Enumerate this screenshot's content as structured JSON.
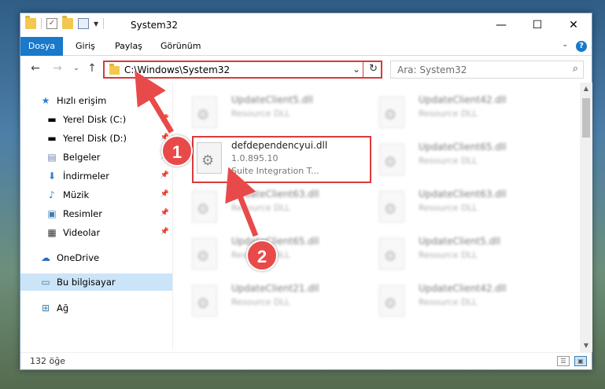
{
  "window": {
    "title": "System32",
    "controls": [
      "—",
      "☐",
      "✕"
    ]
  },
  "ribbon": {
    "tabs": [
      "Dosya",
      "Giriş",
      "Paylaş",
      "Görünüm"
    ],
    "help": "?"
  },
  "address": {
    "path": "C:\\Windows\\System32",
    "search_placeholder": "Ara: System32"
  },
  "sidebar": {
    "items": [
      {
        "label": "Hızlı erişim",
        "icon": "star-icon"
      },
      {
        "label": "Yerel Disk (C:)",
        "icon": "drive-icon"
      },
      {
        "label": "Yerel Disk (D:)",
        "icon": "drive-icon"
      },
      {
        "label": "Belgeler",
        "icon": "documents-icon"
      },
      {
        "label": "İndirmeler",
        "icon": "download-icon"
      },
      {
        "label": "Müzik",
        "icon": "music-icon"
      },
      {
        "label": "Resimler",
        "icon": "pictures-icon"
      },
      {
        "label": "Videolar",
        "icon": "video-icon"
      },
      {
        "label": "OneDrive",
        "icon": "cloud-icon"
      },
      {
        "label": "Bu bilgisayar",
        "icon": "computer-icon"
      },
      {
        "label": "Ağ",
        "icon": "network-icon"
      }
    ]
  },
  "files": {
    "highlighted": {
      "name": "defdependencyui.dll",
      "version": "1.0.895.10",
      "description": "Suite Integration T..."
    },
    "left_column": [
      {
        "name": "UpdateClient5.dll",
        "desc": "Resource DLL"
      },
      {
        "name": "UpdateClient63.dll",
        "desc": "Resource DLL"
      },
      {
        "name": "UpdateClient65.dll",
        "desc": "Resource DLL"
      },
      {
        "name": "UpdateClient21.dll",
        "desc": "Resource DLL"
      }
    ],
    "right_column": [
      {
        "name": "UpdateClient42.dll",
        "desc": "Resource DLL"
      },
      {
        "name": "UpdateClient65.dll",
        "desc": "Resource DLL"
      },
      {
        "name": "UpdateClient63.dll",
        "desc": "Resource DLL"
      },
      {
        "name": "UpdateClient5.dll",
        "desc": "Resource DLL"
      },
      {
        "name": "UpdateClient42.dll",
        "desc": "Resource DLL"
      }
    ]
  },
  "status": {
    "count": "132 öğe"
  },
  "annotations": {
    "step1": "1",
    "step2": "2",
    "color": "#e84a4a"
  }
}
